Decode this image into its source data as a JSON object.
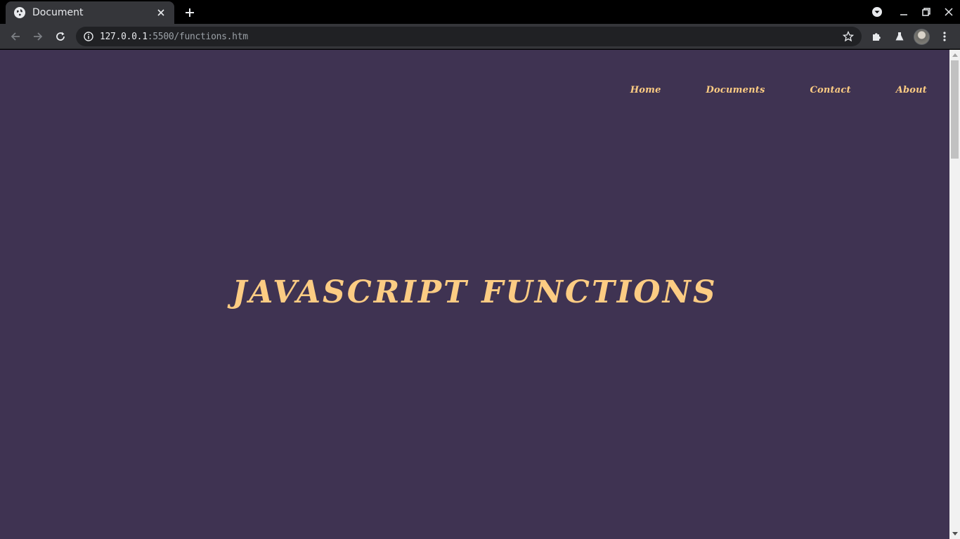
{
  "browser": {
    "tab_title": "Document",
    "url_host": "127.0.0.1",
    "url_port": ":5500",
    "url_path": "/functions.htm"
  },
  "site": {
    "nav": [
      "Home",
      "Documents",
      "Contact",
      "About"
    ],
    "hero_title": "JAVASCRIPT FUNCTIONS"
  },
  "colors": {
    "page_bg": "#3f3352",
    "accent": "#fccc83"
  }
}
